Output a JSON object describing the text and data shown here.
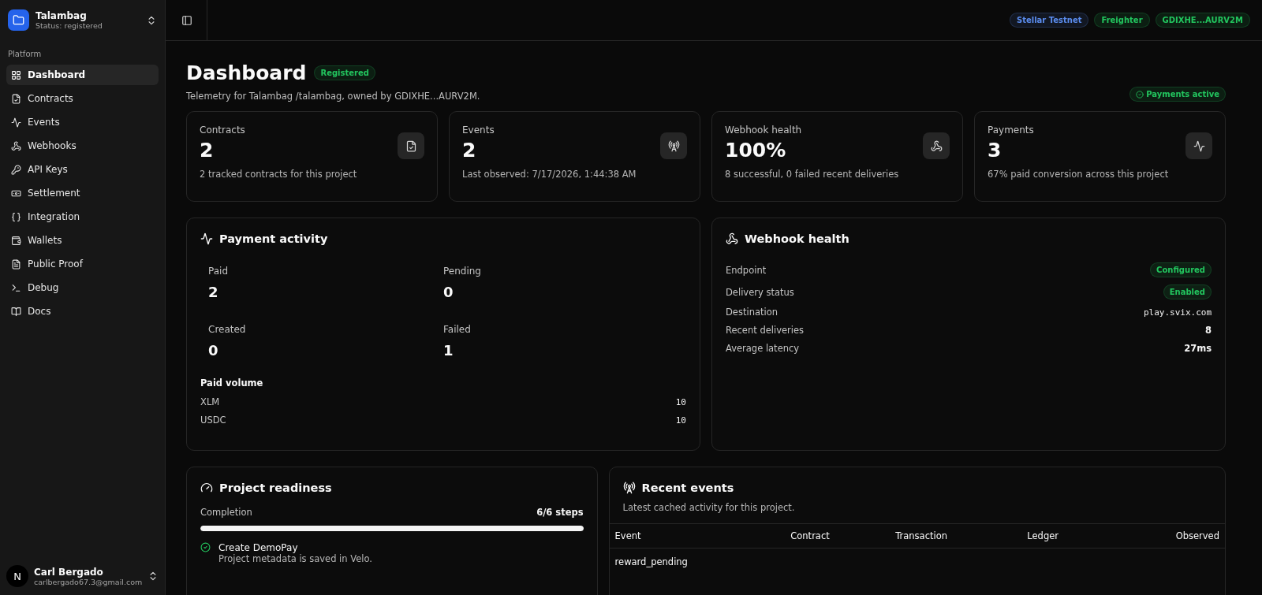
{
  "sidebar": {
    "project": {
      "name": "Talambag",
      "status": "Status: registered"
    },
    "section": "Platform",
    "items": [
      {
        "label": "Dashboard",
        "selected": true
      },
      {
        "label": "Contracts",
        "selected": false
      },
      {
        "label": "Events",
        "selected": false
      },
      {
        "label": "Webhooks",
        "selected": false
      },
      {
        "label": "API Keys",
        "selected": false
      },
      {
        "label": "Settlement",
        "selected": false
      },
      {
        "label": "Integration",
        "selected": false
      },
      {
        "label": "Wallets",
        "selected": false
      },
      {
        "label": "Public Proof",
        "selected": false
      },
      {
        "label": "Debug",
        "selected": false
      },
      {
        "label": "Docs",
        "selected": false
      }
    ],
    "user": {
      "initial": "N",
      "name": "Carl Bergado",
      "email": "carlbergado67.3@gmail.com"
    }
  },
  "topbar": {
    "badges": [
      {
        "label": "Stellar Testnet",
        "color": "#5b8def"
      },
      {
        "label": "Freighter",
        "color": "#22c55e"
      },
      {
        "label": "GDIXHE...AURV2M",
        "color": "#22c55e"
      }
    ]
  },
  "header": {
    "title": "Dashboard",
    "status_badge": "Registered",
    "subtitle": "Telemetry for Talambag /talambag, owned by GDIXHE...AURV2M.",
    "payments_badge": "Payments active"
  },
  "stats": [
    {
      "label": "Contracts",
      "value": "2",
      "caption": "2 tracked contracts for this project"
    },
    {
      "label": "Events",
      "value": "2",
      "caption": "Last observed: 7/17/2026, 1:44:38 AM"
    },
    {
      "label": "Webhook health",
      "value": "100%",
      "caption": "8 successful, 0 failed recent deliveries"
    },
    {
      "label": "Payments",
      "value": "3",
      "caption": "67% paid conversion across this project"
    }
  ],
  "payment_activity": {
    "title": "Payment activity",
    "metrics": [
      {
        "label": "Paid",
        "value": "2"
      },
      {
        "label": "Pending",
        "value": "0"
      },
      {
        "label": "Created",
        "value": "0"
      },
      {
        "label": "Failed",
        "value": "1"
      }
    ],
    "volume_title": "Paid volume",
    "volume": [
      {
        "asset": "XLM",
        "amount": "10"
      },
      {
        "asset": "USDC",
        "amount": "10"
      }
    ]
  },
  "webhook_health": {
    "title": "Webhook health",
    "rows": [
      {
        "label": "Endpoint",
        "value": "Configured",
        "kind": "badge"
      },
      {
        "label": "Delivery status",
        "value": "Enabled",
        "kind": "badge"
      },
      {
        "label": "Destination",
        "value": "play.svix.com",
        "kind": "mono"
      },
      {
        "label": "Recent deliveries",
        "value": "8",
        "kind": "text"
      },
      {
        "label": "Average latency",
        "value": "27ms",
        "kind": "text"
      }
    ]
  },
  "readiness": {
    "title": "Project readiness",
    "completion_label": "Completion",
    "steps_label": "6/6 steps",
    "level": 1,
    "steps": [
      {
        "title": "Create DemoPay",
        "description": "Project metadata is saved in Velo.",
        "done": true
      }
    ]
  },
  "recent_events": {
    "title": "Recent events",
    "subtitle": "Latest cached activity for this project.",
    "columns": [
      "Event",
      "Contract",
      "Transaction",
      "Ledger",
      "Observed"
    ],
    "rows": [
      {
        "event": "reward_pending"
      }
    ]
  }
}
